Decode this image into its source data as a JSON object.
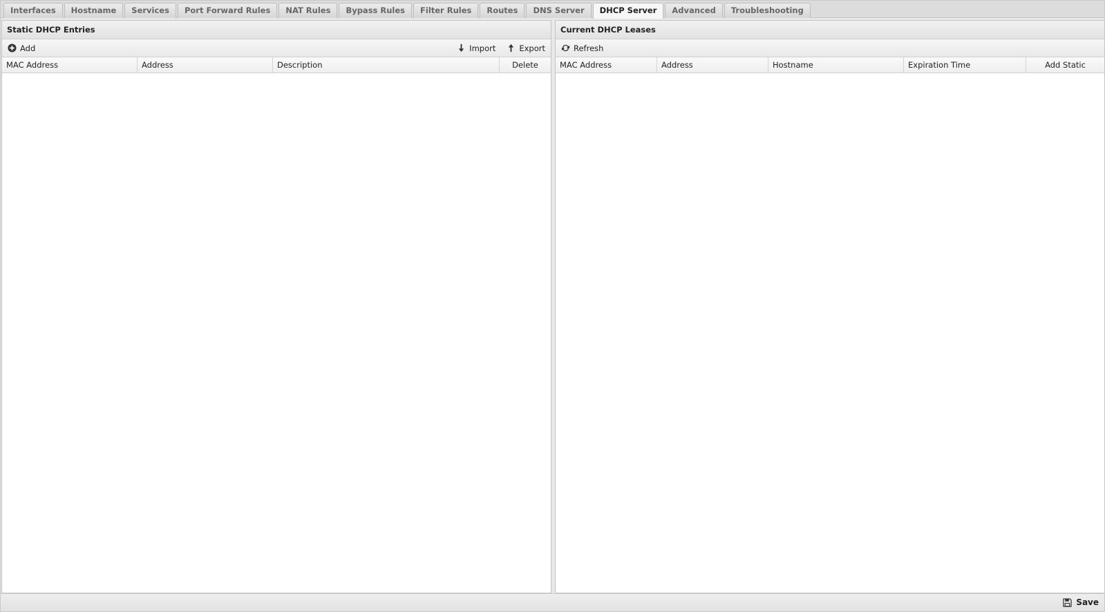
{
  "tabs": [
    {
      "label": "Interfaces",
      "active": false
    },
    {
      "label": "Hostname",
      "active": false
    },
    {
      "label": "Services",
      "active": false
    },
    {
      "label": "Port Forward Rules",
      "active": false
    },
    {
      "label": "NAT Rules",
      "active": false
    },
    {
      "label": "Bypass Rules",
      "active": false
    },
    {
      "label": "Filter Rules",
      "active": false
    },
    {
      "label": "Routes",
      "active": false
    },
    {
      "label": "DNS Server",
      "active": false
    },
    {
      "label": "DHCP Server",
      "active": true
    },
    {
      "label": "Advanced",
      "active": false
    },
    {
      "label": "Troubleshooting",
      "active": false
    }
  ],
  "static_panel": {
    "title": "Static DHCP Entries",
    "add_label": "Add",
    "import_label": "Import",
    "export_label": "Export",
    "columns": [
      "MAC Address",
      "Address",
      "Description",
      "Delete"
    ]
  },
  "leases_panel": {
    "title": "Current DHCP Leases",
    "refresh_label": "Refresh",
    "columns": [
      "MAC Address",
      "Address",
      "Hostname",
      "Expiration Time",
      "Add Static"
    ]
  },
  "footer": {
    "save_label": "Save"
  }
}
